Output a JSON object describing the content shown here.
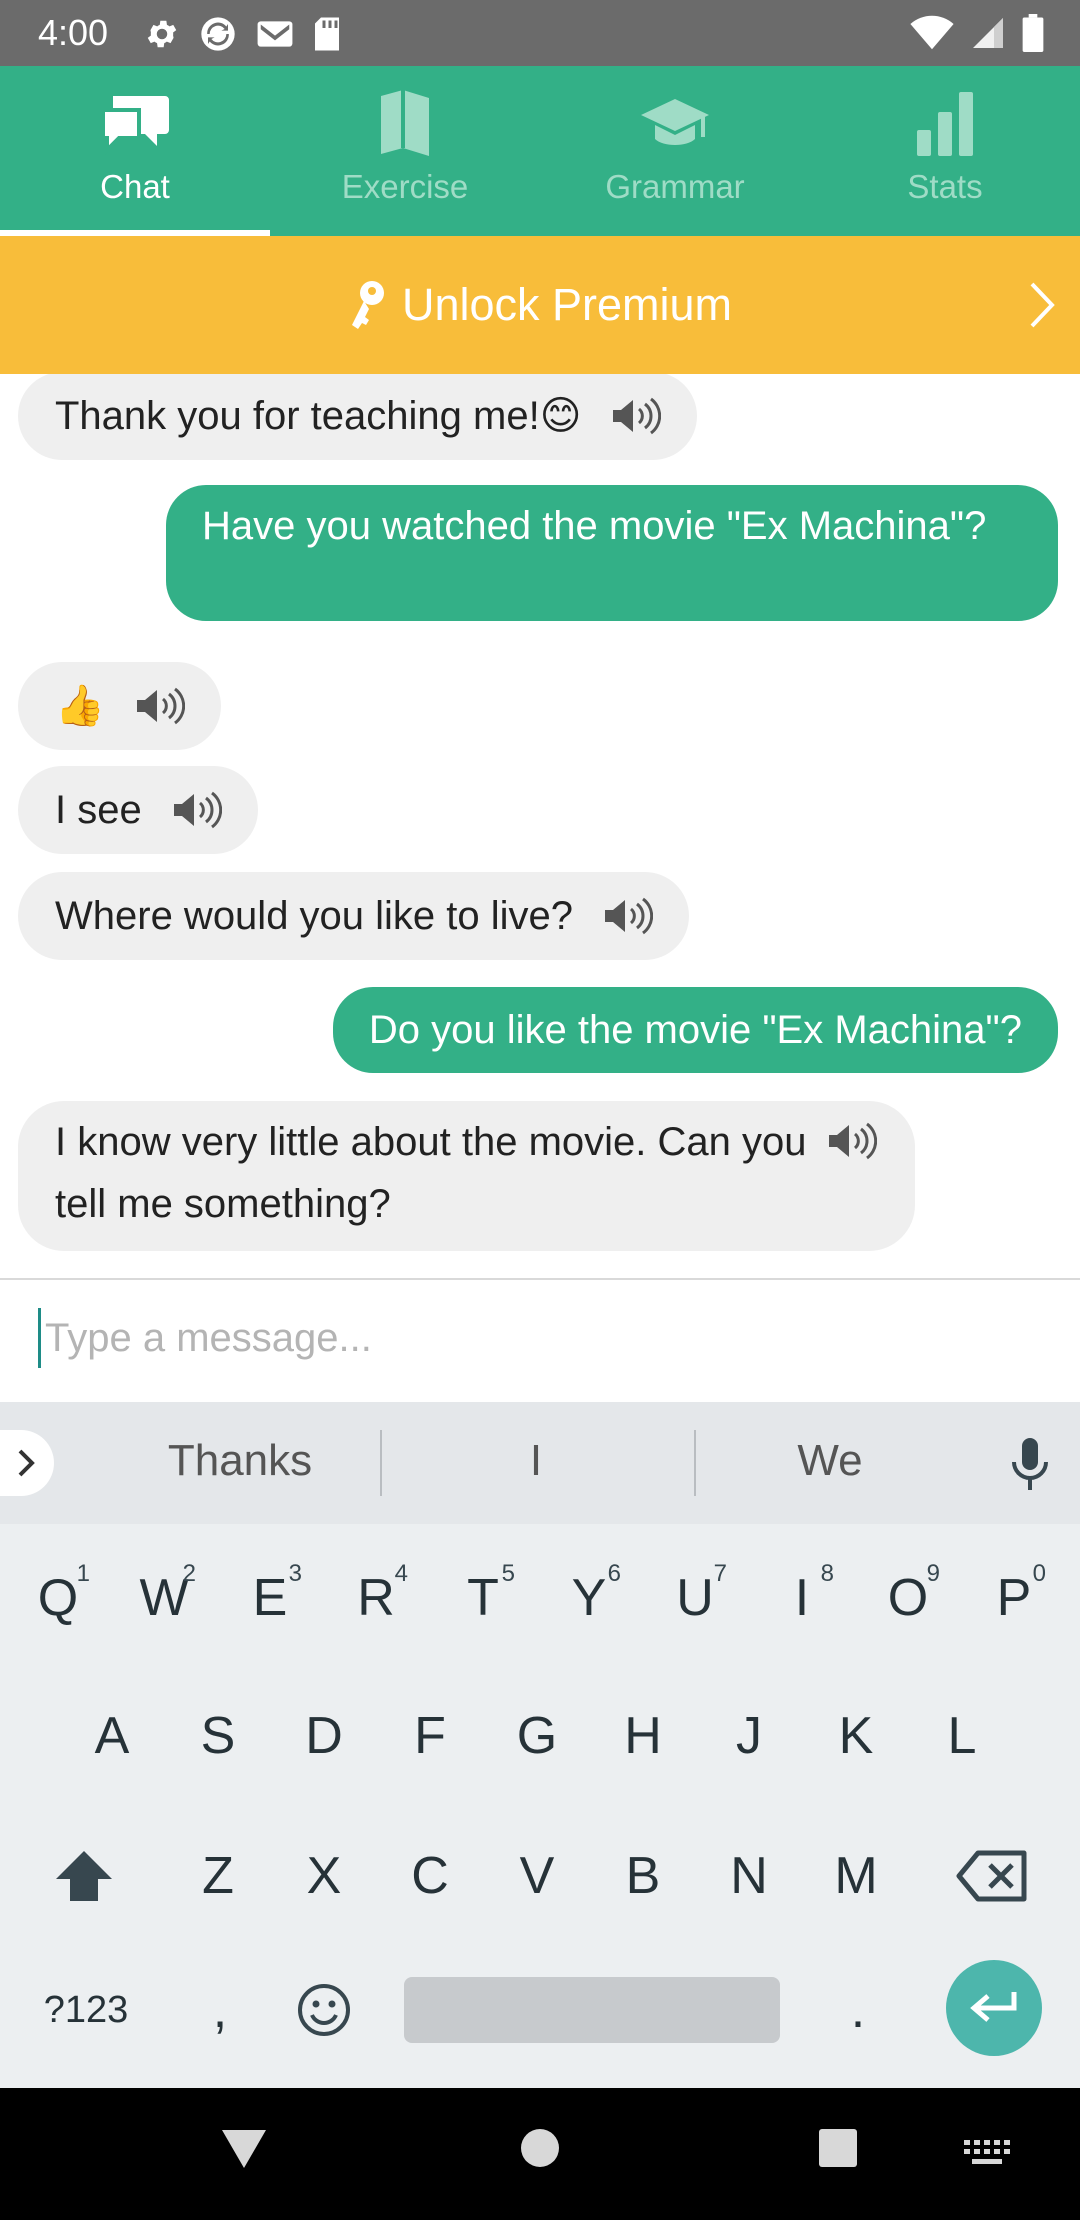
{
  "status_bar": {
    "time": "4:00"
  },
  "tabs": [
    {
      "label": "Chat",
      "icon": "chat-icon",
      "active": true
    },
    {
      "label": "Exercise",
      "icon": "book-icon",
      "active": false
    },
    {
      "label": "Grammar",
      "icon": "graduation-cap-icon",
      "active": false
    },
    {
      "label": "Stats",
      "icon": "bar-chart-icon",
      "active": false
    }
  ],
  "premium": {
    "label": "Unlock Premium",
    "icon": "key-icon"
  },
  "messages": [
    {
      "from": "bot",
      "text": "Thank you for teaching me!😊"
    },
    {
      "from": "user",
      "text": "Have you watched the movie \"Ex Machina\"?"
    },
    {
      "from": "bot",
      "text": "👍"
    },
    {
      "from": "bot",
      "text": "I see"
    },
    {
      "from": "bot",
      "text": "Where would you like to live?"
    },
    {
      "from": "user",
      "text": "Do you like the movie \"Ex Machina\"?"
    },
    {
      "from": "bot",
      "text": "I know very little about the movie. Can you tell me something?"
    }
  ],
  "input": {
    "placeholder": "Type a message..."
  },
  "keyboard": {
    "suggestions": [
      "Thanks",
      "I",
      "We"
    ],
    "row1": [
      "Q",
      "W",
      "E",
      "R",
      "T",
      "Y",
      "U",
      "I",
      "O",
      "P"
    ],
    "row1_hints": [
      "1",
      "2",
      "3",
      "4",
      "5",
      "6",
      "7",
      "8",
      "9",
      "0"
    ],
    "row2": [
      "A",
      "S",
      "D",
      "F",
      "G",
      "H",
      "J",
      "K",
      "L"
    ],
    "row3": [
      "Z",
      "X",
      "C",
      "V",
      "B",
      "N",
      "M"
    ],
    "symbols_label": "?123",
    "comma": ",",
    "period": "."
  },
  "colors": {
    "primary": "#33b087",
    "premium": "#f8bd3a",
    "bubble_in": "#efefef",
    "enter": "#4db6ac"
  }
}
